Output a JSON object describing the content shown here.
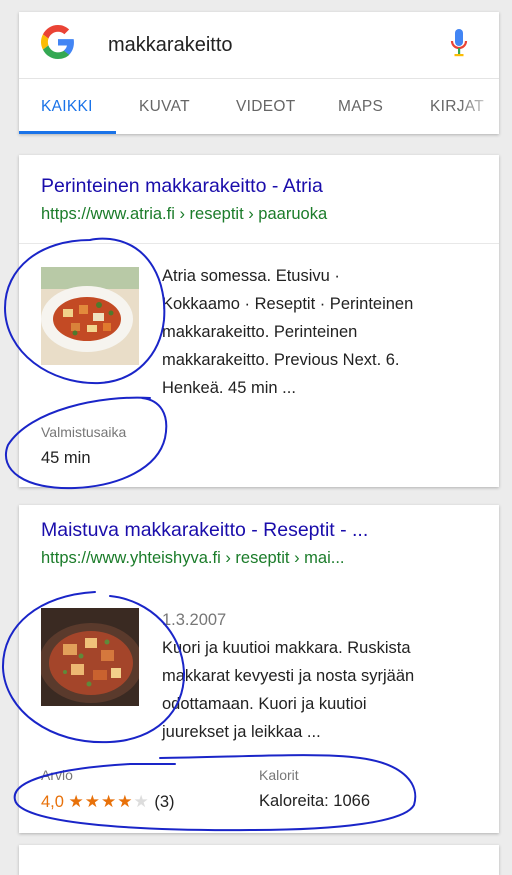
{
  "search": {
    "query": "makkarakeitto",
    "tabs": [
      {
        "label": "KAIKKI",
        "active": true
      },
      {
        "label": "KUVAT"
      },
      {
        "label": "VIDEOT"
      },
      {
        "label": "MAPS"
      },
      {
        "label": "KIRJAT"
      }
    ]
  },
  "results": [
    {
      "title": "Perinteinen makkarakeitto - Atria",
      "url": "https://www.atria.fi › reseptit › paaruoka",
      "snippet_lines": [
        "Atria somessa. Etusivu ·",
        "Kokkaamo · Reseptit · Perinteinen",
        "makkarakeitto. Perinteinen",
        "makkarakeitto. Previous Next. 6.",
        "Henkeä. 45 min ..."
      ],
      "meta_label": "Valmistusaika",
      "meta_value": "45 min"
    },
    {
      "title": "Maistuva makkarakeitto - Reseptit - ...",
      "url": "https://www.yhteishyva.fi › reseptit › mai...",
      "date": "1.3.2007",
      "snippet_lines": [
        "Kuori ja kuutioi makkara. Ruskista",
        "makkarat kevyesti ja nosta syrjään",
        "odottamaan. Kuori ja kuutioi",
        "juurekset ja leikkaa ..."
      ],
      "rating_label": "Arvio",
      "rating_value": "4,0",
      "rating_stars": 4,
      "rating_count": "(3)",
      "calories_label": "Kalorit",
      "calories_value": "Kaloreita: 1066"
    }
  ],
  "colors": {
    "link": "#1a0dab",
    "url": "#1b7c2a",
    "accent": "#1a73e8",
    "rating": "#e8710a",
    "annotation": "#1a25c8"
  },
  "icons": [
    "google-logo-icon",
    "microphone-icon",
    "star-icon"
  ]
}
